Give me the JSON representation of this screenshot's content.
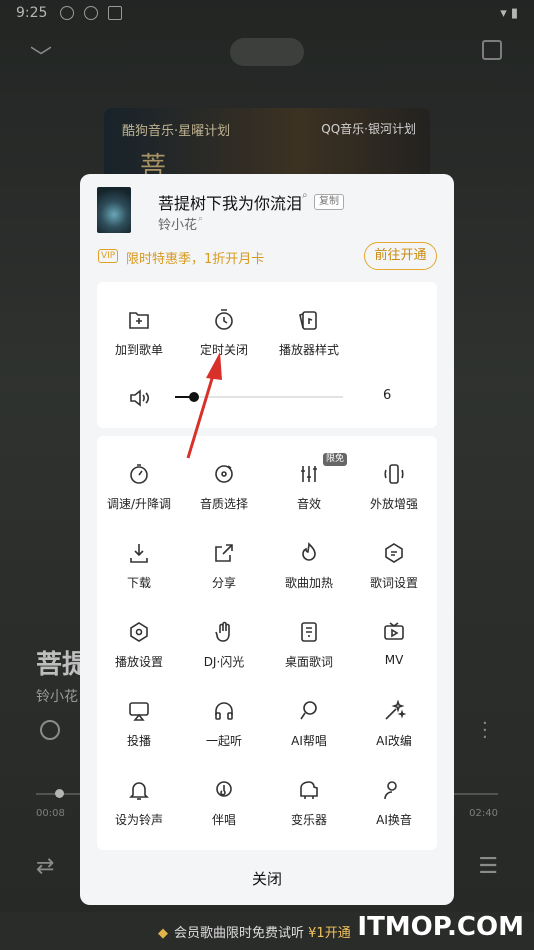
{
  "status_bar": {
    "time": "9:25",
    "battery": "▮"
  },
  "background": {
    "cover_left_text": "酷狗音乐·星曜计划",
    "cover_right_text": "QQ音乐·银河计划",
    "cover_big_char": "菩",
    "title": "菩提",
    "artist": "铃小花",
    "time_current": "00:08",
    "time_total": "02:40",
    "progress_fraction": 0.05
  },
  "sheet": {
    "song": {
      "title": "菩提树下我为你流泪",
      "artist": "铃小花",
      "copy_label": "复制"
    },
    "vip": {
      "badge": "VIP",
      "text": "限时特惠季，1折开月卡",
      "button": "前往开通"
    },
    "top_items": [
      {
        "name": "add-to-playlist",
        "label": "加到歌单",
        "icon": "folder-plus-icon"
      },
      {
        "name": "sleep-timer",
        "label": "定时关闭",
        "icon": "timer-icon"
      },
      {
        "name": "player-style",
        "label": "播放器样式",
        "icon": "cards-icon"
      }
    ],
    "volume": {
      "value": "6",
      "level_fraction": 0.1
    },
    "new_badge": "限免",
    "grid_items": [
      {
        "label": "调速/升降调",
        "icon": "speed-icon"
      },
      {
        "label": "音质选择",
        "icon": "quality-icon"
      },
      {
        "label": "音效",
        "icon": "equalizer-icon"
      },
      {
        "label": "外放增强",
        "icon": "speaker-boost-icon"
      },
      {
        "label": "下载",
        "icon": "download-icon"
      },
      {
        "label": "分享",
        "icon": "share-icon"
      },
      {
        "label": "歌曲加热",
        "icon": "flame-icon"
      },
      {
        "label": "歌词设置",
        "icon": "lyrics-settings-icon"
      },
      {
        "label": "播放设置",
        "icon": "hexagon-icon"
      },
      {
        "label": "DJ·闪光",
        "icon": "dj-hand-icon"
      },
      {
        "label": "桌面歌词",
        "icon": "desktop-lyrics-icon"
      },
      {
        "label": "MV",
        "icon": "tv-icon"
      },
      {
        "label": "投播",
        "icon": "cast-icon"
      },
      {
        "label": "一起听",
        "icon": "headphones-icon"
      },
      {
        "label": "AI帮唱",
        "icon": "ai-mic-icon"
      },
      {
        "label": "AI改编",
        "icon": "sparkle-wand-icon"
      },
      {
        "label": "设为铃声",
        "icon": "bell-icon"
      },
      {
        "label": "伴唱",
        "icon": "accompany-icon"
      },
      {
        "label": "变乐器",
        "icon": "piano-icon"
      },
      {
        "label": "AI换音",
        "icon": "ai-voice-icon"
      }
    ],
    "close_label": "关闭"
  },
  "bottom_bar": {
    "text": "会员歌曲限时免费试听",
    "price": "¥1开通"
  },
  "watermark": {
    "text": "ITMOP.COM"
  },
  "colors": {
    "accent": "#e6a82e",
    "arrow": "#d9302a"
  }
}
